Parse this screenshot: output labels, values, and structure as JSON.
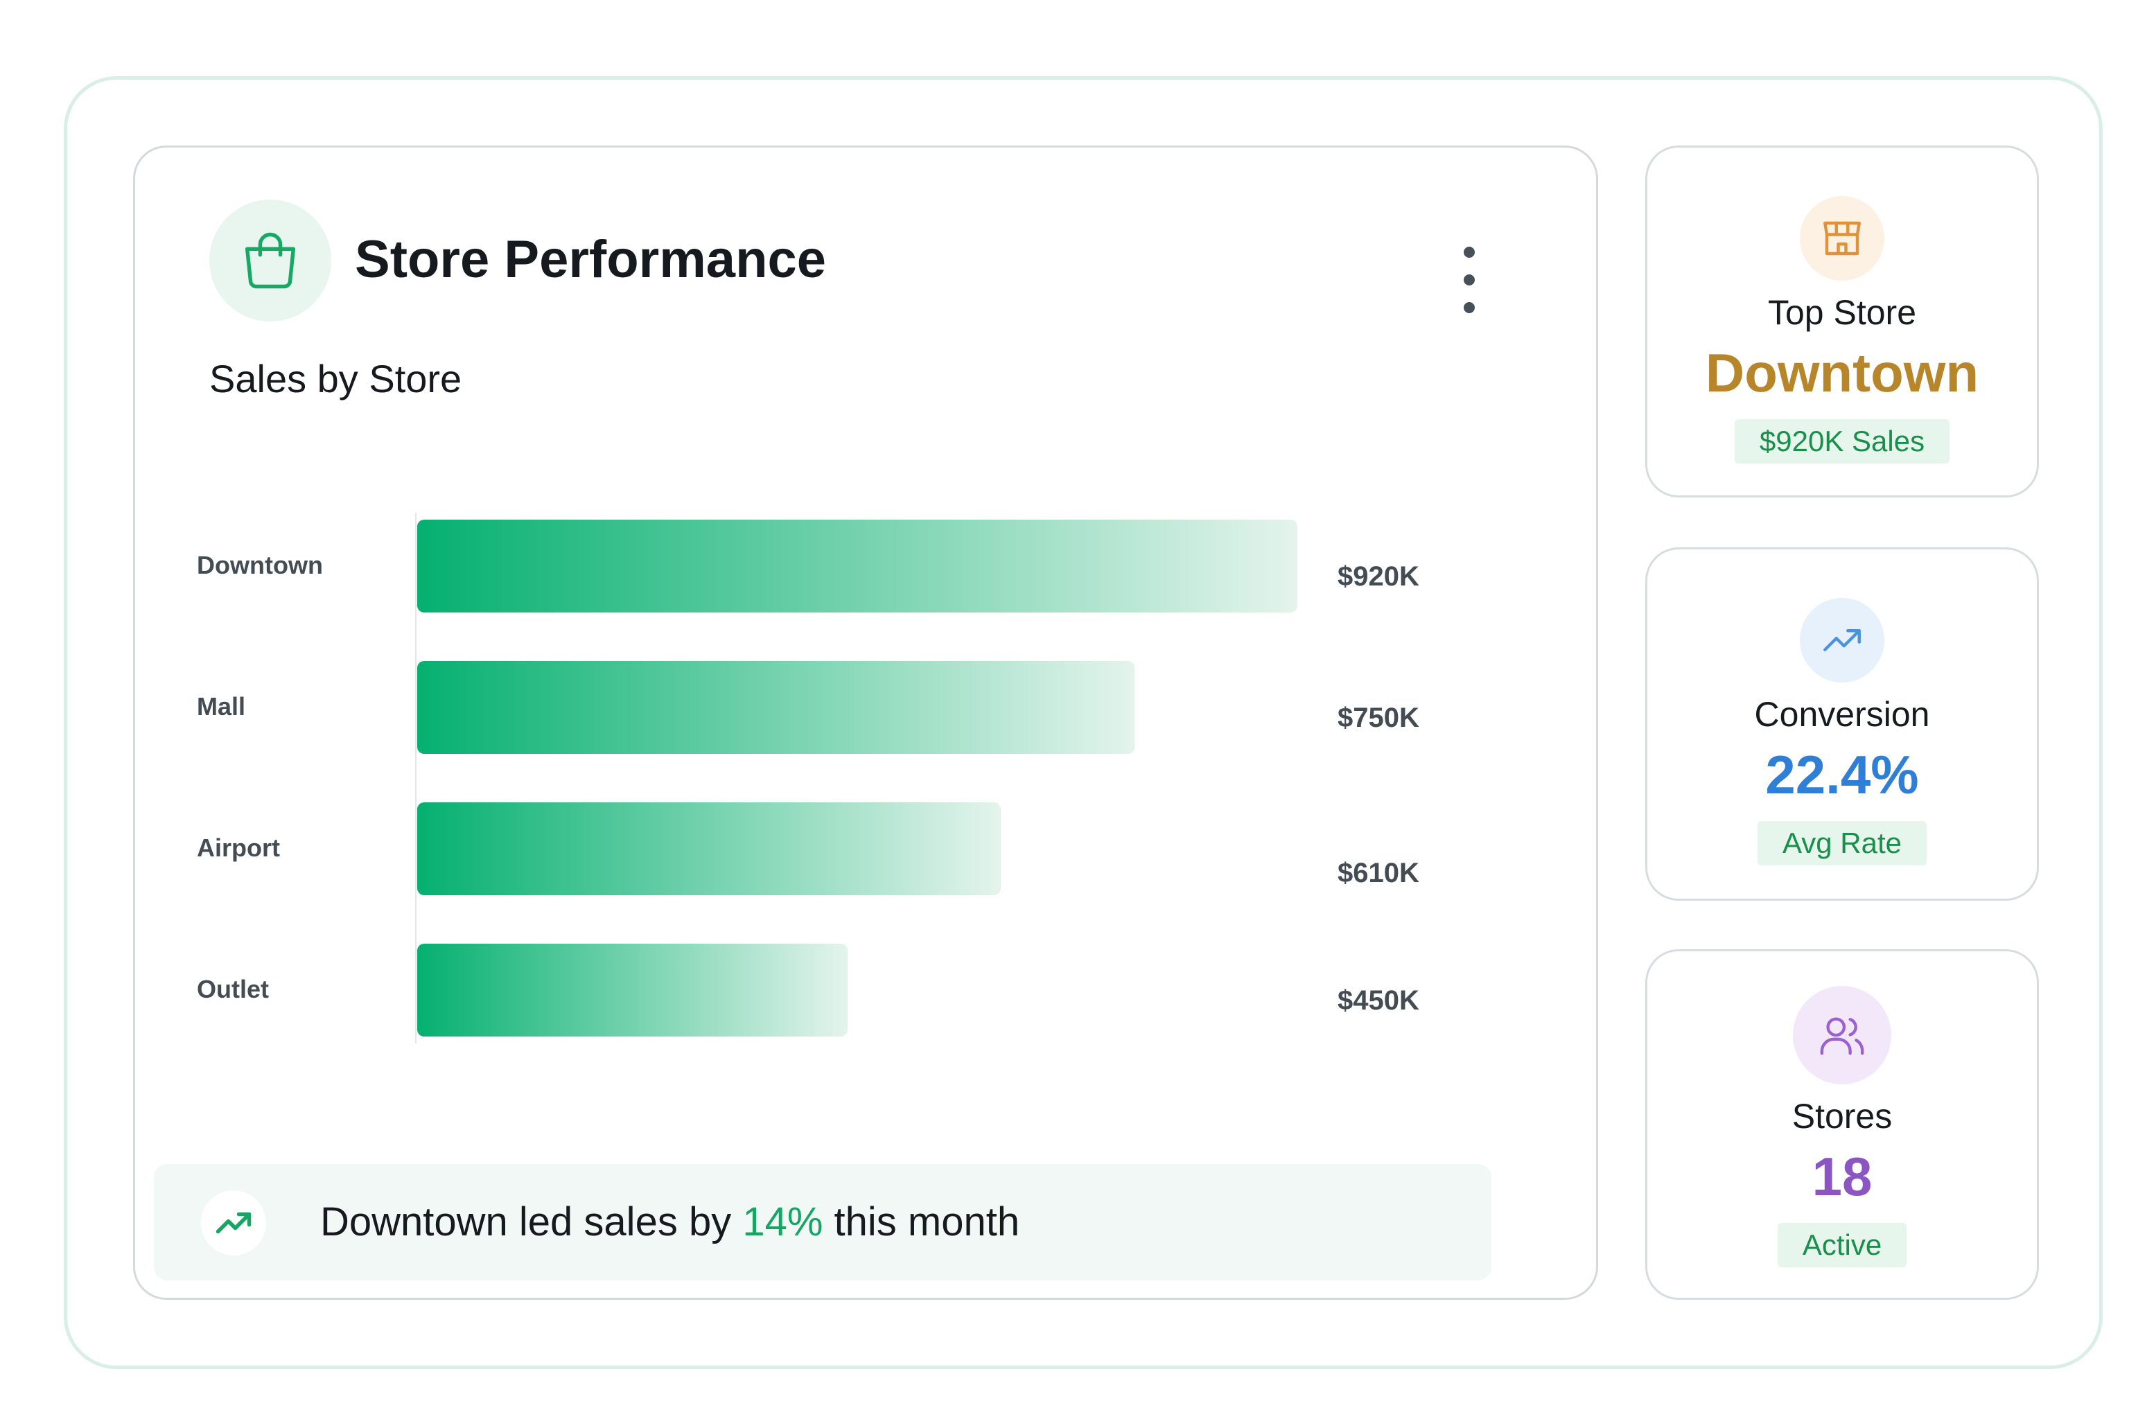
{
  "header": {
    "title": "Store Performance",
    "icon": "shopping-bag-icon",
    "menu_icon": "kebab-menu-icon"
  },
  "chart_data": {
    "type": "bar",
    "orientation": "horizontal",
    "title": "Sales by Store",
    "categories": [
      "Downtown",
      "Mall",
      "Airport",
      "Outlet"
    ],
    "values": [
      920,
      750,
      610,
      450
    ],
    "unit": "$K",
    "data_labels": [
      "$920K",
      "$750K",
      "$610K",
      "$450K"
    ],
    "xlabel": "",
    "ylabel": "",
    "xlim": [
      0,
      920
    ],
    "grid": false,
    "legend": "none",
    "colors": {
      "bar_start": "#05b070",
      "bar_end": "#e4f4ec",
      "axis": "#e3e6e8"
    }
  },
  "insight": {
    "icon": "trending-up-icon",
    "text_before": "Downtown led sales by ",
    "highlight": "14%",
    "text_after": " this month",
    "highlight_color": "#16a663"
  },
  "stats": [
    {
      "icon": "store-icon",
      "label": "Top Store",
      "value": "Downtown",
      "badge": "$920K Sales",
      "value_color": "#b8862a",
      "icon_bg": "#fdf1e3",
      "icon_color": "#e0913a",
      "badge_bg": "#e6f6ec",
      "badge_color": "#1a8f4c"
    },
    {
      "icon": "trending-up-icon",
      "label": "Conversion",
      "value": "22.4%",
      "badge": "Avg Rate",
      "value_color": "#2f7fd6",
      "icon_bg": "#e6f1fc",
      "icon_color": "#4a93dc",
      "badge_bg": "#e6f6ec",
      "badge_color": "#1a8f4c"
    },
    {
      "icon": "users-icon",
      "label": "Stores",
      "value": "18",
      "badge": "Active",
      "value_color": "#8c55c4",
      "icon_bg": "#f2e8fa",
      "icon_color": "#9b62cf",
      "badge_bg": "#e6f6ec",
      "badge_color": "#1a8f4c"
    }
  ]
}
